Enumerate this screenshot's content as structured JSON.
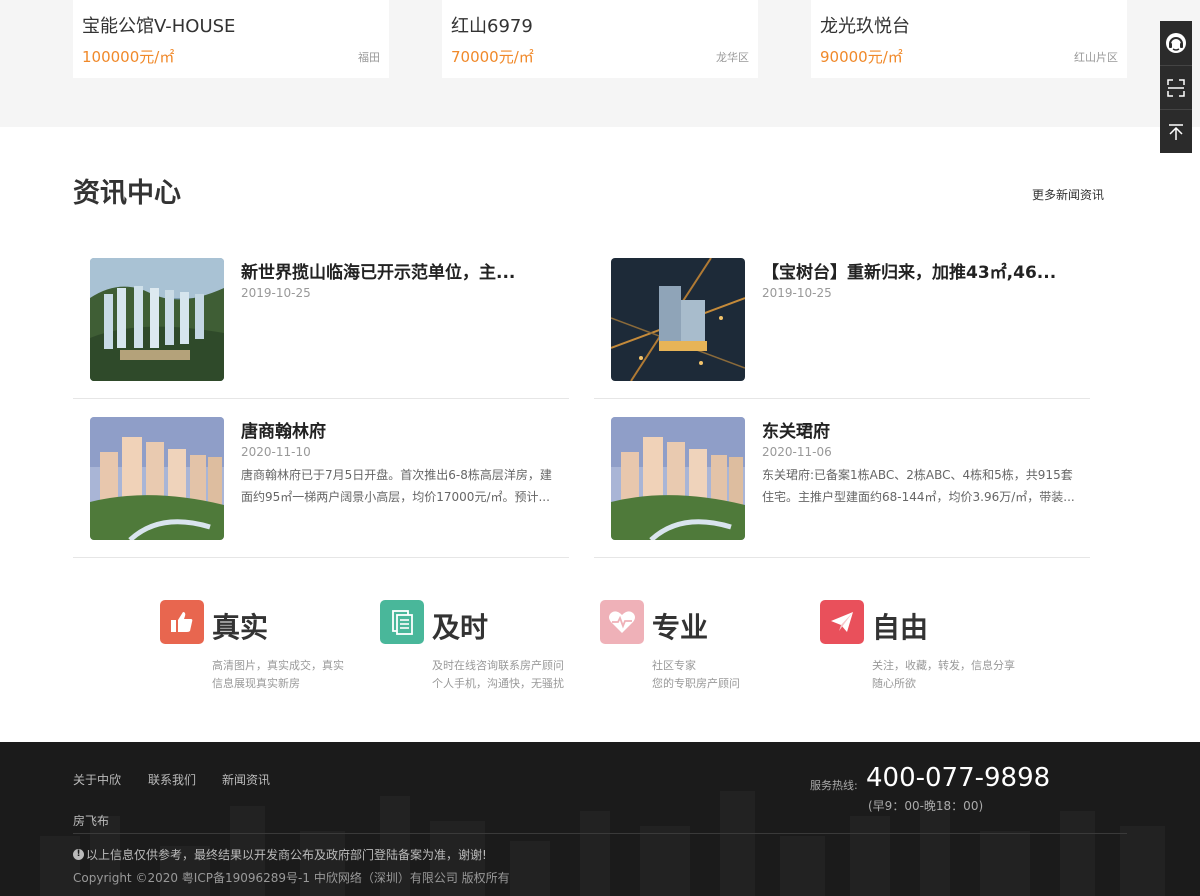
{
  "properties": [
    {
      "name": "宝能公馆V-HOUSE",
      "price": "100000元/㎡",
      "area": "福田"
    },
    {
      "name": "红山6979",
      "price": "70000元/㎡",
      "area": "龙华区"
    },
    {
      "name": "龙光玖悦台",
      "price": "90000元/㎡",
      "area": "红山片区"
    }
  ],
  "side_toolbar": {
    "icons": [
      "headset-icon",
      "scan-icon",
      "back-to-top-icon"
    ]
  },
  "news": {
    "title": "资讯中心",
    "more_label": "更多新闻资讯",
    "items": [
      {
        "title": "新世界揽山临海已开示范单位，主...",
        "date": "2019-10-25",
        "desc": ""
      },
      {
        "title": "【宝树台】重新归来，加推43㎡,46...",
        "date": "2019-10-25",
        "desc": ""
      },
      {
        "title": "唐商翰林府",
        "date": "2020-11-10",
        "desc": "唐商翰林府已于7月5日开盘。首次推出6-8栋高层洋房，建面约95㎡一梯两户阔景小高层，均价17000元/㎡。预计..."
      },
      {
        "title": "东关珺府",
        "date": "2020-11-06",
        "desc": "东关珺府:已备案1栋ABC、2栋ABC、4栋和5栋，共915套住宅。主推户型建面约68-144㎡，均价3.96万/㎡，带装..."
      }
    ]
  },
  "features": [
    {
      "title": "真实",
      "line1": "高清图片，真实成交，真实",
      "line2": "信息展现真实新房",
      "color": "#e8664f",
      "icon": "thumbs-up-icon"
    },
    {
      "title": "及时",
      "line1": "及时在线咨询联系房产顾问",
      "line2": "个人手机，沟通快，无骚扰",
      "color": "#49b79a",
      "icon": "document-icon"
    },
    {
      "title": "专业",
      "line1": "社区专家",
      "line2": "您的专职房产顾问",
      "color": "#efb1b8",
      "icon": "heart-pulse-icon"
    },
    {
      "title": "自由",
      "line1": "关注，收藏，转发，信息分享",
      "line2": "随心所欲",
      "color": "#e9505b",
      "icon": "paper-plane-icon"
    }
  ],
  "footer": {
    "links": [
      "关于中欣",
      "联系我们",
      "新闻资讯",
      "房飞布"
    ],
    "hotline_label": "服务热线:",
    "hotline": "400-077-9898",
    "hours": "(早9：00-晚18：00)",
    "disclaimer": "以上信息仅供参考，最终结果以开发商公布及政府部门登陆备案为准，谢谢!",
    "copyright": "Copyright ©2020 粤ICP备19096289号-1 中欣网络（深圳）有限公司 版权所有"
  }
}
